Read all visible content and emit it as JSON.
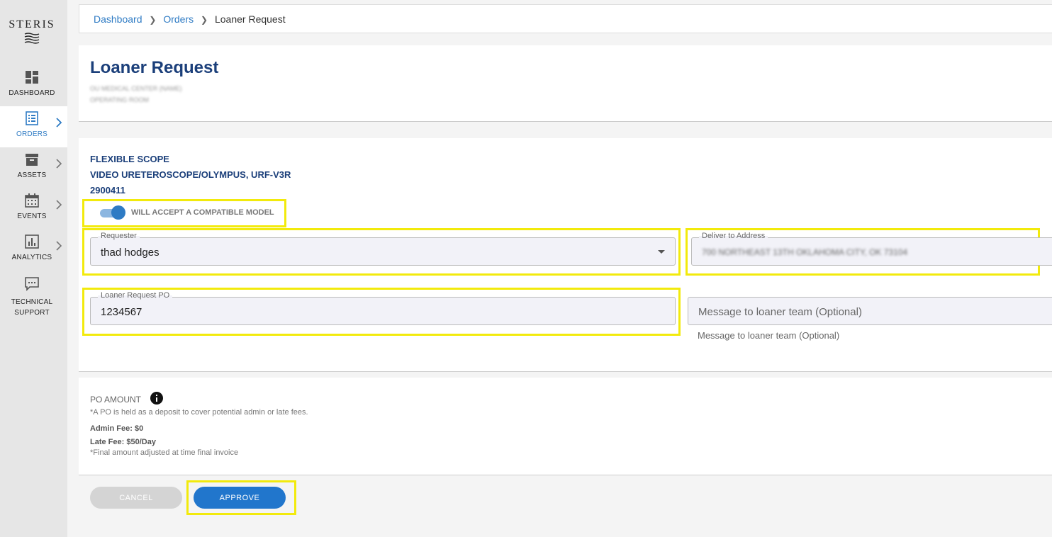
{
  "sidebar": {
    "logo": "STERIS",
    "items": [
      {
        "label": "DASHBOARD"
      },
      {
        "label": "ORDERS"
      },
      {
        "label": "ASSETS"
      },
      {
        "label": "EVENTS"
      },
      {
        "label": "ANALYTICS"
      },
      {
        "label_line1": "TECHNICAL",
        "label_line2": "SUPPORT"
      }
    ]
  },
  "breadcrumb": {
    "items": [
      "Dashboard",
      "Orders"
    ],
    "current": "Loaner Request"
  },
  "header": {
    "title": "Loaner Request",
    "subtitle_line1": "OU MEDICAL CENTER (NAME)",
    "subtitle_line2": "OPERATING ROOM"
  },
  "item": {
    "category": "FLEXIBLE SCOPE",
    "model": "VIDEO URETEROSCOPE/OLYMPUS, URF-V3R",
    "number": "2900411"
  },
  "toggle": {
    "label": "WILL ACCEPT A COMPATIBLE MODEL",
    "on": true
  },
  "form": {
    "requester": {
      "label": "Requester",
      "value": "thad hodges"
    },
    "deliver_to": {
      "label": "Deliver to Address",
      "value": "700 NORTHEAST 13TH OKLAHOMA CITY, OK 73104"
    },
    "po": {
      "label": "Loaner Request PO",
      "value": "1234567"
    },
    "message": {
      "placeholder": "Message to loaner team (Optional)",
      "helper": "Message to loaner team (Optional)"
    }
  },
  "po_amount": {
    "title": "PO AMOUNT",
    "note": "*A PO is held as a deposit to cover potential admin or late fees.",
    "admin_fee": "Admin Fee: $0",
    "late_fee": "Late Fee: $50/Day",
    "final_note": "*Final amount adjusted at time final invoice"
  },
  "actions": {
    "cancel": "CANCEL",
    "approve": "APPROVE"
  },
  "colors": {
    "accent": "#2176cc",
    "title": "#1b3f7a",
    "highlight": "#f2ea0c"
  }
}
